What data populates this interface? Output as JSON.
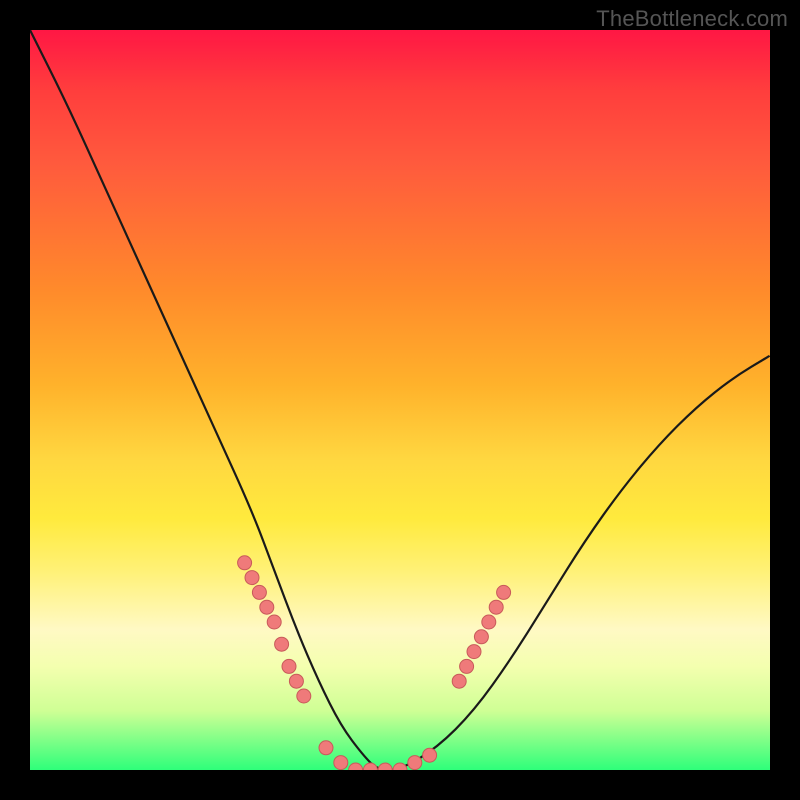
{
  "watermark": "TheBottleneck.com",
  "colors": {
    "curve_stroke": "#1a1a1a",
    "dot_fill": "#ef7a7a",
    "dot_stroke": "#c85a5a",
    "bg": "#000000"
  },
  "chart_data": {
    "type": "line",
    "title": "",
    "xlabel": "",
    "ylabel": "",
    "xlim": [
      0,
      100
    ],
    "ylim": [
      0,
      100
    ],
    "grid": false,
    "legend": false,
    "series": [
      {
        "name": "bottleneck-curve",
        "x": [
          0,
          5,
          10,
          15,
          20,
          25,
          30,
          33,
          36,
          39,
          42,
          45,
          47,
          50,
          55,
          60,
          65,
          70,
          75,
          80,
          85,
          90,
          95,
          100
        ],
        "values": [
          100,
          90,
          79,
          68,
          57,
          46,
          35,
          27,
          19,
          12,
          6,
          2,
          0,
          0,
          3,
          8,
          15,
          23,
          31,
          38,
          44,
          49,
          53,
          56
        ]
      }
    ],
    "markers": [
      {
        "name": "left-cluster",
        "x": [
          29,
          30,
          31,
          32,
          33,
          34,
          35,
          36,
          37
        ],
        "y": [
          28,
          26,
          24,
          22,
          20,
          17,
          14,
          12,
          10
        ]
      },
      {
        "name": "bottom-band",
        "x": [
          40,
          42,
          44,
          46,
          48,
          50,
          52,
          54
        ],
        "y": [
          3,
          1,
          0,
          0,
          0,
          0,
          1,
          2
        ]
      },
      {
        "name": "right-cluster",
        "x": [
          58,
          59,
          60,
          61,
          62,
          63,
          64
        ],
        "y": [
          12,
          14,
          16,
          18,
          20,
          22,
          24
        ]
      }
    ]
  }
}
